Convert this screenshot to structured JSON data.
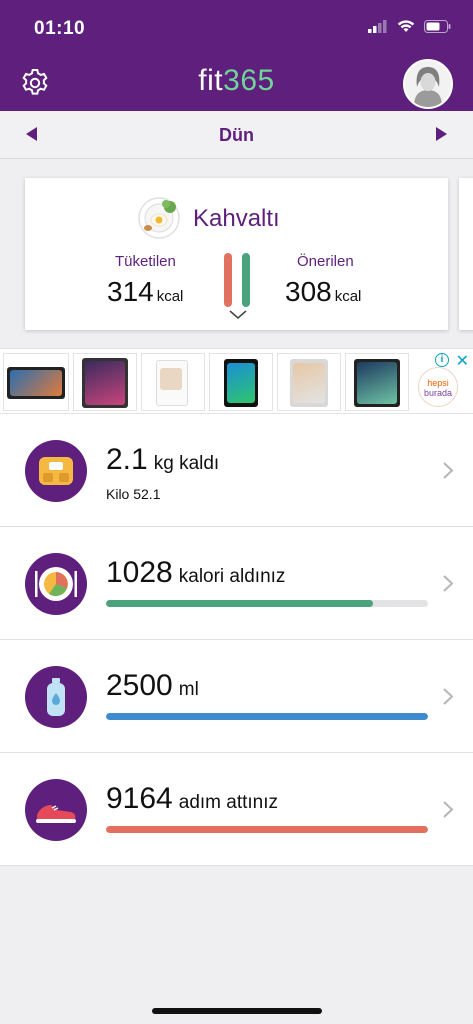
{
  "status": {
    "time": "01:10"
  },
  "header": {
    "logo_fit": "fit",
    "logo_num": "365",
    "settings_icon": "gear-icon",
    "avatar_icon": "avatar-icon"
  },
  "datebar": {
    "label": "Dün"
  },
  "meal": {
    "title": "Kahvaltı",
    "consumed_label": "Tüketilen",
    "consumed_value": "314",
    "consumed_unit": "kcal",
    "recommended_label": "Önerilen",
    "recommended_value": "308",
    "recommended_unit": "kcal"
  },
  "ad": {
    "brand_line1": "hepsi",
    "brand_line2": "burada",
    "info_icon": "info-icon",
    "close_icon": "close-icon"
  },
  "rows": [
    {
      "icon": "scale-icon",
      "value": "2.1",
      "label": "kg kaldı",
      "sub": "Kilo 52.1"
    },
    {
      "icon": "plate-icon",
      "value": "1028",
      "label": "kalori aldınız",
      "progress": 0.83,
      "color": "#4aa37d"
    },
    {
      "icon": "water-bottle-icon",
      "value": "2500",
      "label": "ml",
      "progress": 1.0,
      "color": "#3f8bd0"
    },
    {
      "icon": "sneaker-icon",
      "value": "9164",
      "label": "adım attınız",
      "progress": 1.0,
      "color": "#e2705f"
    }
  ],
  "colors": {
    "brand": "#5e1f7d",
    "accent": "#6fd39a"
  }
}
